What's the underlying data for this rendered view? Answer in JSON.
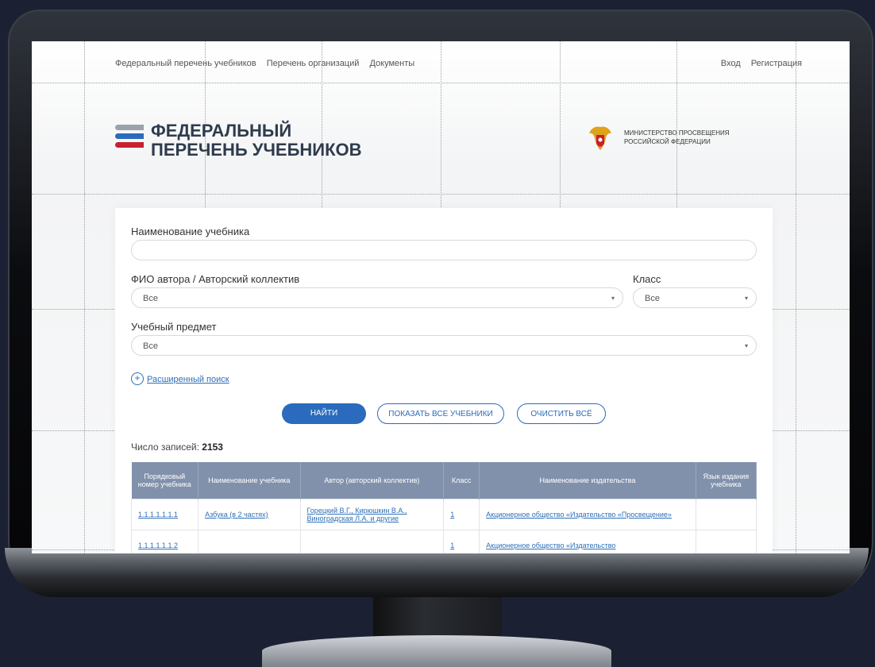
{
  "topnav": {
    "left": [
      "Федеральный перечень учебников",
      "Перечень организаций",
      "Документы"
    ],
    "right": [
      "Вход",
      "Регистрация"
    ]
  },
  "logo": {
    "line1": "ФЕДЕРАЛЬНЫЙ",
    "line2": "ПЕРЕЧЕНЬ УЧЕБНИКОВ"
  },
  "ministry": {
    "line1": "МИНИСТЕРСТВО ПРОСВЕЩЕНИЯ",
    "line2": "РОССИЙСКОЙ ФЕДЕРАЦИИ"
  },
  "form": {
    "title_label": "Наименование учебника",
    "title_value": "",
    "author_label": "ФИО автора / Авторский коллектив",
    "author_value": "Все",
    "class_label": "Класс",
    "class_value": "Все",
    "subject_label": "Учебный предмет",
    "subject_value": "Все",
    "advanced_search": "Расширенный поиск",
    "find_button": "НАЙТИ",
    "show_all_button": "ПОКАЗАТЬ ВСЕ УЧЕБНИКИ",
    "clear_button": "ОЧИСТИТЬ ВСЁ"
  },
  "results": {
    "count_label": "Число записей:",
    "count_value": "2153",
    "headers": [
      "Порядковый номер учебника",
      "Наименование учебника",
      "Автор (авторский коллектив)",
      "Класс",
      "Наименование издательства",
      "Язык издания учебника"
    ],
    "rows": [
      [
        "1.1.1.1.1.1.1",
        "Азбука (в 2 частях)",
        "Горецкий В.Г., Кирюшкин В.А., Виноградская Л.А. и другие",
        "1",
        "Акционерное общество «Издательство «Просвещение»",
        ""
      ],
      [
        "1.1.1.1.1.1.2",
        "",
        "",
        "1",
        "Акционерное общество «Издательство",
        ""
      ]
    ]
  },
  "colors": {
    "accent": "#2a6bbd",
    "table_header": "#8191ab",
    "logo_blue": "#2a6bbd",
    "logo_red": "#c8202f",
    "logo_gray": "#9aa3ad"
  }
}
